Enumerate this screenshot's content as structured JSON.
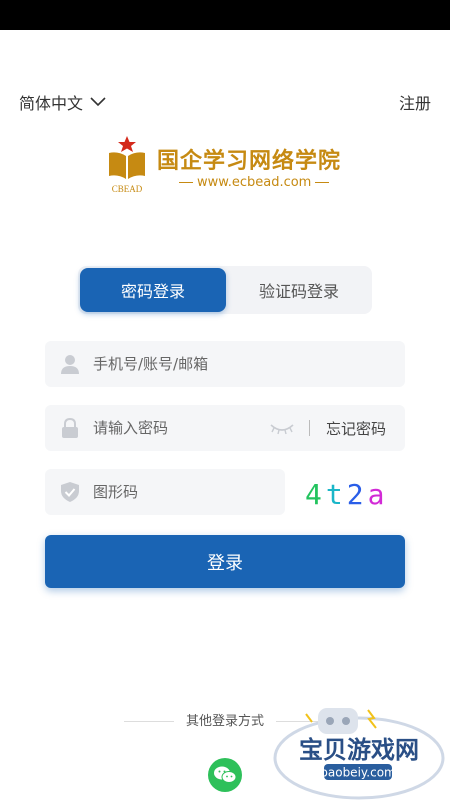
{
  "header": {
    "language_label": "简体中文",
    "register_label": "注册"
  },
  "logo": {
    "title": "国企学习网络学院",
    "url": "www.ecbead.com",
    "emblem_text": "CBEAD",
    "brand_color": "#c68a12"
  },
  "tabs": [
    {
      "label": "密码登录",
      "active": true
    },
    {
      "label": "验证码登录",
      "active": false
    }
  ],
  "form": {
    "account_placeholder": "手机号/账号/邮箱",
    "password_placeholder": "请输入密码",
    "forgot_label": "忘记密码",
    "captcha_placeholder": "图形码",
    "captcha_chars": [
      "4",
      "t",
      "2",
      "a"
    ],
    "login_label": "登录"
  },
  "other_login": {
    "label": "其他登录方式",
    "methods": [
      "wechat"
    ]
  },
  "watermark": {
    "title": "宝贝游戏网",
    "url": "baobeiy.com"
  },
  "colors": {
    "primary": "#1a64b4",
    "wechat": "#2ec05a"
  }
}
